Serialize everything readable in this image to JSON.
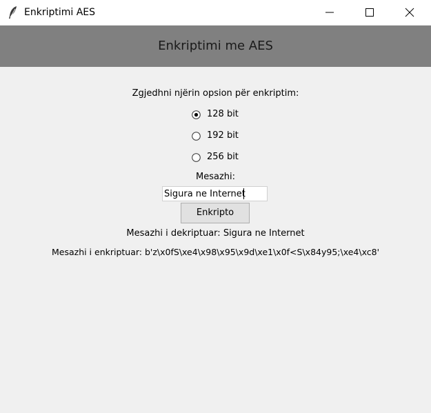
{
  "window": {
    "title": "Enkriptimi AES"
  },
  "banner": {
    "title": "Enkriptimi me AES"
  },
  "form": {
    "prompt": "Zgjedhni njërin opsion për enkriptim:",
    "options": [
      {
        "label": "128 bit",
        "selected": true
      },
      {
        "label": "192 bit",
        "selected": false
      },
      {
        "label": "256 bit",
        "selected": false
      }
    ],
    "message_label": "Mesazhi:",
    "message_value": "Sigura ne Internet",
    "encrypt_button": "Enkripto"
  },
  "results": {
    "decrypted": "Mesazhi i dekriptuar: Sigura ne Internet",
    "encrypted": "Mesazhi i enkriptuar: b'z\\x0fS\\xe4\\x98\\x95\\x9d\\xe1\\x0f<S\\x84y95;\\xe4\\xc8'"
  },
  "icons": {
    "app": "feather-icon",
    "minimize": "minimize-icon",
    "maximize": "maximize-icon",
    "close": "close-icon"
  }
}
